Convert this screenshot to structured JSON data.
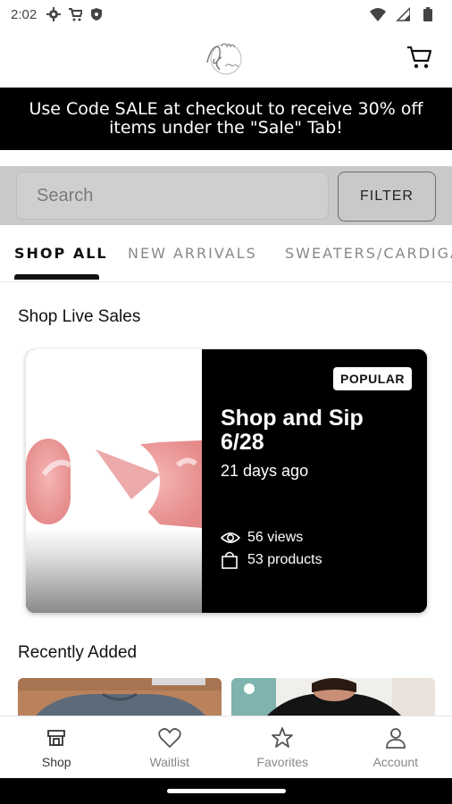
{
  "status_bar": {
    "time": "2:02",
    "icons": [
      "gear-icon",
      "cart-icon",
      "shield-icon",
      "wifi-icon",
      "signal-icon",
      "battery-icon"
    ]
  },
  "header": {
    "logo_alt_icon": "annies-closet-logo",
    "cart_icon": "cart-icon"
  },
  "promo": {
    "text": "Use Code SALE at checkout to receive 30% off items under the \"Sale\" Tab!"
  },
  "search": {
    "placeholder": "Search",
    "filter_label": "FILTER"
  },
  "tabs": [
    {
      "label": "SHOP ALL",
      "active": true
    },
    {
      "label": "NEW ARRIVALS",
      "active": false
    },
    {
      "label": "SWEATERS/CARDIGANS",
      "active": false
    }
  ],
  "live_sales": {
    "section_title": "Shop Live Sales",
    "card": {
      "badge": "POPULAR",
      "title": "Shop and Sip 6/28",
      "time_ago": "21 days ago",
      "views": "56 views",
      "products": "53 products"
    }
  },
  "recently_added": {
    "section_title": "Recently Added"
  },
  "bottom_nav": [
    {
      "label": "Shop",
      "icon": "shop-icon",
      "active": true
    },
    {
      "label": "Waitlist",
      "icon": "heart-icon",
      "active": false
    },
    {
      "label": "Favorites",
      "icon": "star-icon",
      "active": false
    },
    {
      "label": "Account",
      "icon": "person-icon",
      "active": false
    }
  ],
  "colors": {
    "accent": "#000000",
    "promo_bg": "#000000",
    "search_bg": "#c9c9c9"
  }
}
